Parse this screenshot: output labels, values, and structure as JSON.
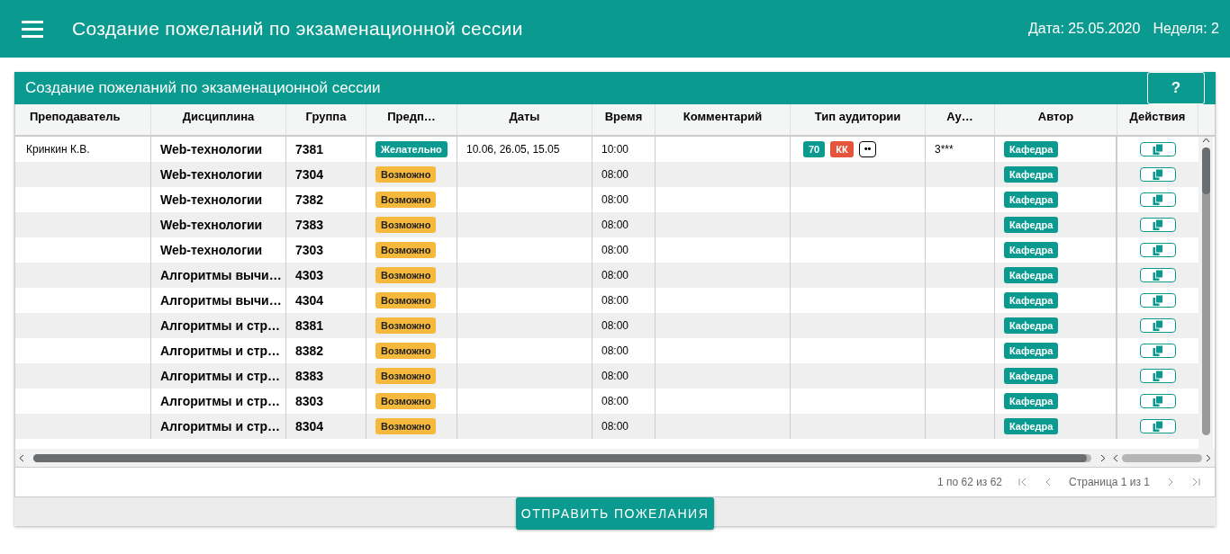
{
  "app_bar": {
    "title": "Создание пожеланий по экзаменационной сессии",
    "date": "Дата: 25.05.2020",
    "week": "Неделя: 2"
  },
  "panel": {
    "title": "Создание пожеланий по экзаменационной сессии",
    "help_button": "?"
  },
  "table": {
    "columns": [
      "Преподаватель",
      "Дисциплина",
      "Группа",
      "Предп…",
      "Даты",
      "Время",
      "Комментарий",
      "Тип аудитории",
      "Ау…",
      "Автор",
      "Действия"
    ],
    "rows": [
      {
        "teacher": "Кринкин К.В.",
        "discipline": "Web-технологии",
        "group": "7381",
        "priority": {
          "label": "Желательно",
          "kind": "desired"
        },
        "dates": "10.06, 26.05, 15.05",
        "time": "10:00",
        "room_types": [
          {
            "label": "70",
            "kind": "capacity"
          },
          {
            "label": "КК",
            "kind": "computer"
          },
          {
            "label": "••",
            "kind": "outline"
          }
        ],
        "room": "3***",
        "author": "Кафедра"
      },
      {
        "discipline": "Web-технологии",
        "group": "7304",
        "priority": {
          "label": "Возможно",
          "kind": "possible"
        },
        "time": "08:00",
        "author": "Кафедра"
      },
      {
        "discipline": "Web-технологии",
        "group": "7382",
        "priority": {
          "label": "Возможно",
          "kind": "possible"
        },
        "time": "08:00",
        "author": "Кафедра"
      },
      {
        "discipline": "Web-технологии",
        "group": "7383",
        "priority": {
          "label": "Возможно",
          "kind": "possible"
        },
        "time": "08:00",
        "author": "Кафедра"
      },
      {
        "discipline": "Web-технологии",
        "group": "7303",
        "priority": {
          "label": "Возможно",
          "kind": "possible"
        },
        "time": "08:00",
        "author": "Кафедра"
      },
      {
        "discipline": "Алгоритмы вычи…",
        "group": "4303",
        "priority": {
          "label": "Возможно",
          "kind": "possible"
        },
        "time": "08:00",
        "author": "Кафедра"
      },
      {
        "discipline": "Алгоритмы вычи…",
        "group": "4304",
        "priority": {
          "label": "Возможно",
          "kind": "possible"
        },
        "time": "08:00",
        "author": "Кафедра"
      },
      {
        "discipline": "Алгоритмы и стр…",
        "group": "8381",
        "priority": {
          "label": "Возможно",
          "kind": "possible"
        },
        "time": "08:00",
        "author": "Кафедра"
      },
      {
        "discipline": "Алгоритмы и стр…",
        "group": "8382",
        "priority": {
          "label": "Возможно",
          "kind": "possible"
        },
        "time": "08:00",
        "author": "Кафедра"
      },
      {
        "discipline": "Алгоритмы и стр…",
        "group": "8383",
        "priority": {
          "label": "Возможно",
          "kind": "possible"
        },
        "time": "08:00",
        "author": "Кафедра"
      },
      {
        "discipline": "Алгоритмы и стр…",
        "group": "8303",
        "priority": {
          "label": "Возможно",
          "kind": "possible"
        },
        "time": "08:00",
        "author": "Кафедра"
      },
      {
        "discipline": "Алгоритмы и стр…",
        "group": "8304",
        "priority": {
          "label": "Возможно",
          "kind": "possible"
        },
        "time": "08:00",
        "author": "Кафедра"
      }
    ]
  },
  "pager": {
    "range": "1 по 62 из 62",
    "page": "Страница 1 из 1"
  },
  "submit_button": "ОТПРАВИТЬ ПОЖЕЛАНИЯ"
}
